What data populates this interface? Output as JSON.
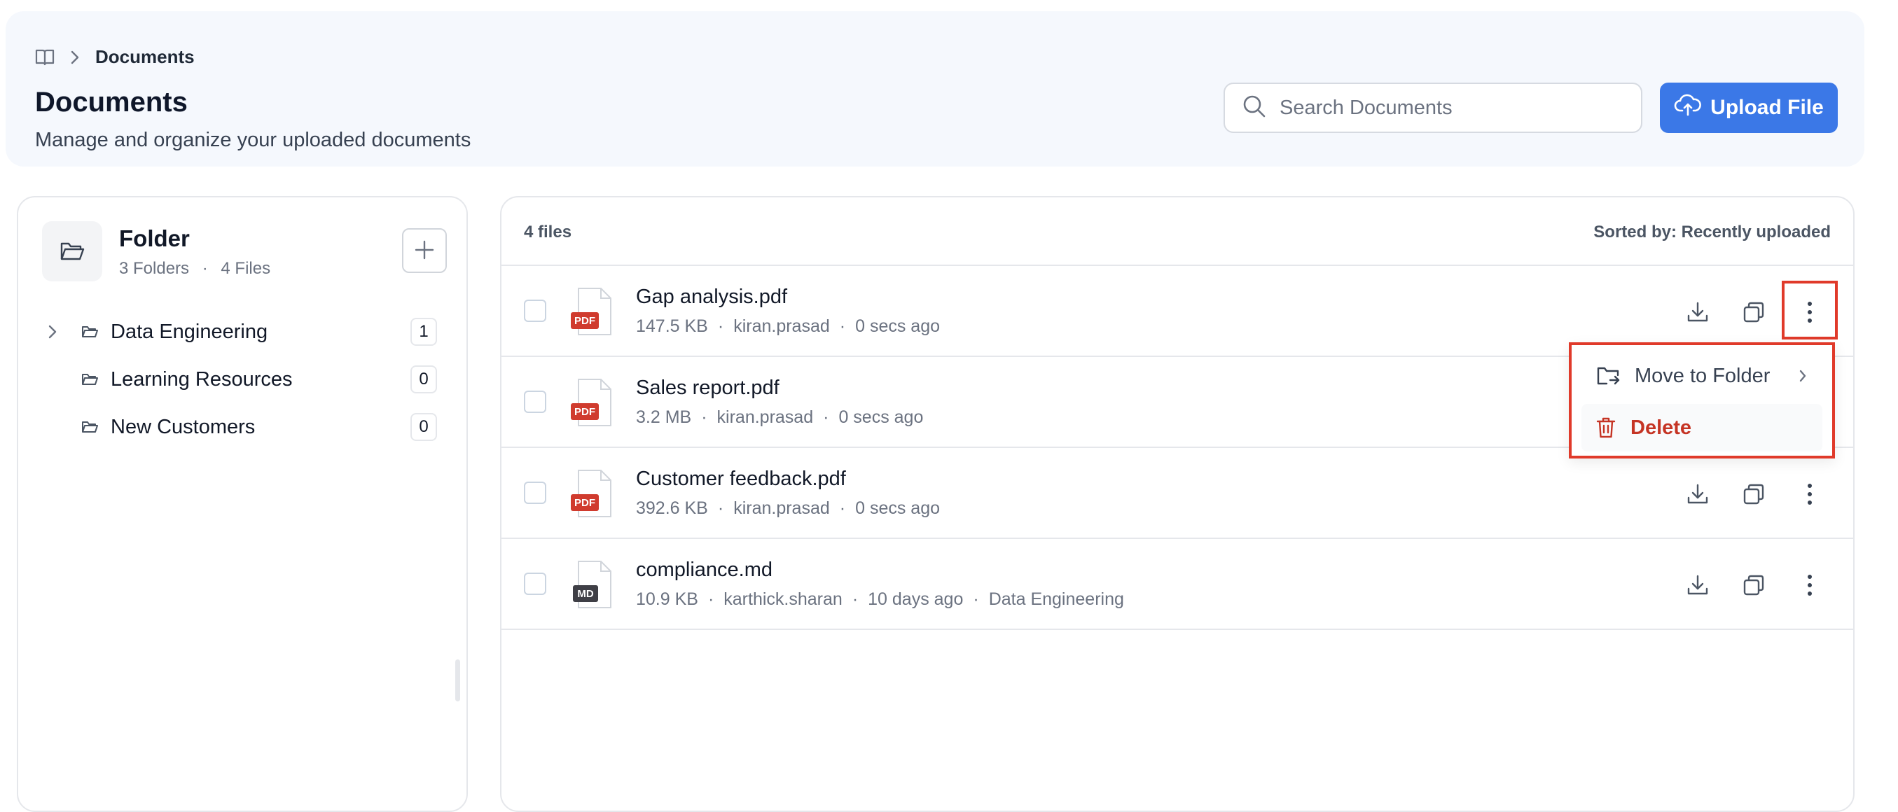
{
  "breadcrumb": {
    "current": "Documents"
  },
  "header": {
    "title": "Documents",
    "subtitle": "Manage and organize your uploaded documents",
    "search_placeholder": "Search Documents",
    "upload_label": "Upload File"
  },
  "sidebar": {
    "title": "Folder",
    "folders_count": "3 Folders",
    "files_count": "4 Files",
    "separator": "·",
    "folders": [
      {
        "name": "Data Engineering",
        "count": "1",
        "expandable": true
      },
      {
        "name": "Learning Resources",
        "count": "0",
        "expandable": false
      },
      {
        "name": "New Customers",
        "count": "0",
        "expandable": false
      }
    ]
  },
  "files": {
    "count_label": "4 files",
    "sorted_label": "Sorted by: Recently uploaded",
    "dot": "·",
    "items": [
      {
        "name": "Gap analysis.pdf",
        "badge": "PDF",
        "size": "147.5 KB",
        "owner": "kiran.prasad",
        "time": "0 secs ago",
        "folder": ""
      },
      {
        "name": "Sales report.pdf",
        "badge": "PDF",
        "size": "3.2 MB",
        "owner": "kiran.prasad",
        "time": "0 secs ago",
        "folder": ""
      },
      {
        "name": "Customer feedback.pdf",
        "badge": "PDF",
        "size": "392.6 KB",
        "owner": "kiran.prasad",
        "time": "0 secs ago",
        "folder": ""
      },
      {
        "name": "compliance.md",
        "badge": "MD",
        "size": "10.9 KB",
        "owner": "karthick.sharan",
        "time": "10 days ago",
        "folder": "Data Engineering"
      }
    ]
  },
  "context_menu": {
    "move_label": "Move to Folder",
    "delete_label": "Delete"
  },
  "colors": {
    "primary": "#3b78e7",
    "danger": "#c53424",
    "highlight": "#e03a2a",
    "pdf_badge": "#d03b2e",
    "md_badge": "#3f3f46"
  },
  "icons": {
    "breadcrumb": "book-open-icon",
    "search": "search-icon",
    "upload": "cloud-upload-icon",
    "folder": "folder-open-icon",
    "add": "plus-icon",
    "download": "download-icon",
    "copy": "copy-icon",
    "more": "more-vertical-icon",
    "move": "folder-move-icon",
    "delete": "trash-icon"
  }
}
